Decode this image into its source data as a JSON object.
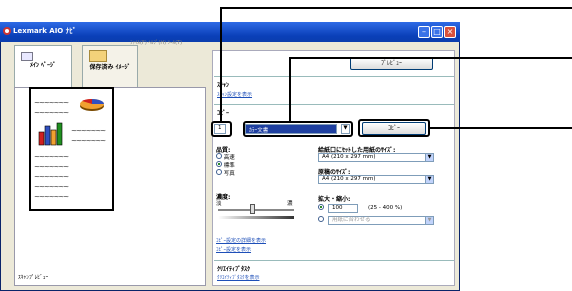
{
  "window": {
    "title": "Lexmark AIO ﾅﾋﾞ",
    "menu_hint": "ﾌｧｲﾙ(F) ﾍﾙﾌﾟ(H) ﾂｰﾙ(T)"
  },
  "tabs": [
    {
      "label": "ﾒｲﾝ ﾍﾟｰｼﾞ"
    },
    {
      "label": "保存済み ｲﾒｰｼﾞ"
    }
  ],
  "preview": {
    "caption": "ｽｷｬﾝﾌﾟﾚﾋﾞｭｰ",
    "squiggle": "~~~~~~~",
    "button_label": "ﾌﾟﾚﾋﾞｭｰ"
  },
  "scan": {
    "heading": "ｽｷｬﾝ",
    "settings_link": "ｽｷｬﾝ設定を表示"
  },
  "copy": {
    "heading": "ｺﾋﾟｰ",
    "count_value": "1",
    "color_value": "ｶﾗｰ文書",
    "copy_button": "ｺﾋﾟｰ",
    "quality_label": "品質:",
    "quality_options": [
      "高速",
      "標準",
      "写真"
    ],
    "paper_size_label": "給紙口にｾｯﾄした用紙のｻｲｽﾞ:",
    "paper_size_value": "A4 (210 x 297 mm)",
    "original_size_label": "原稿のｻｲｽﾞ:",
    "original_size_value": "A4 (210 x 297 mm)",
    "density_label": "濃度:",
    "density_light": "淡",
    "density_dark": "濃",
    "zoom_label": "拡大・縮小:",
    "zoom_value": "100",
    "zoom_range": "(25 - 400 %)",
    "fit_page_value": "用紙に合わせる",
    "advanced_link": "ｺﾋﾟｰ設定の詳細を表示",
    "more_link": "ｺﾋﾟｰ設定を表示"
  },
  "creative": {
    "heading": "ｸﾘｴｲﾃｨﾌﾞﾀｽｸ",
    "link": "ｸﾘｴｲﾃｨﾌﾞﾀｽｸを表示"
  },
  "colors": {
    "titlebar": "#0A3FB8",
    "window_bg": "#ECE9D8",
    "highlight": "#1E3FA0",
    "link": "#1E4FB8"
  },
  "icons": [
    "app-icon",
    "minimize-icon",
    "maximize-icon",
    "close-icon",
    "pie-chart-icon",
    "bar-chart-icon",
    "dropdown-arrow-icon"
  ]
}
